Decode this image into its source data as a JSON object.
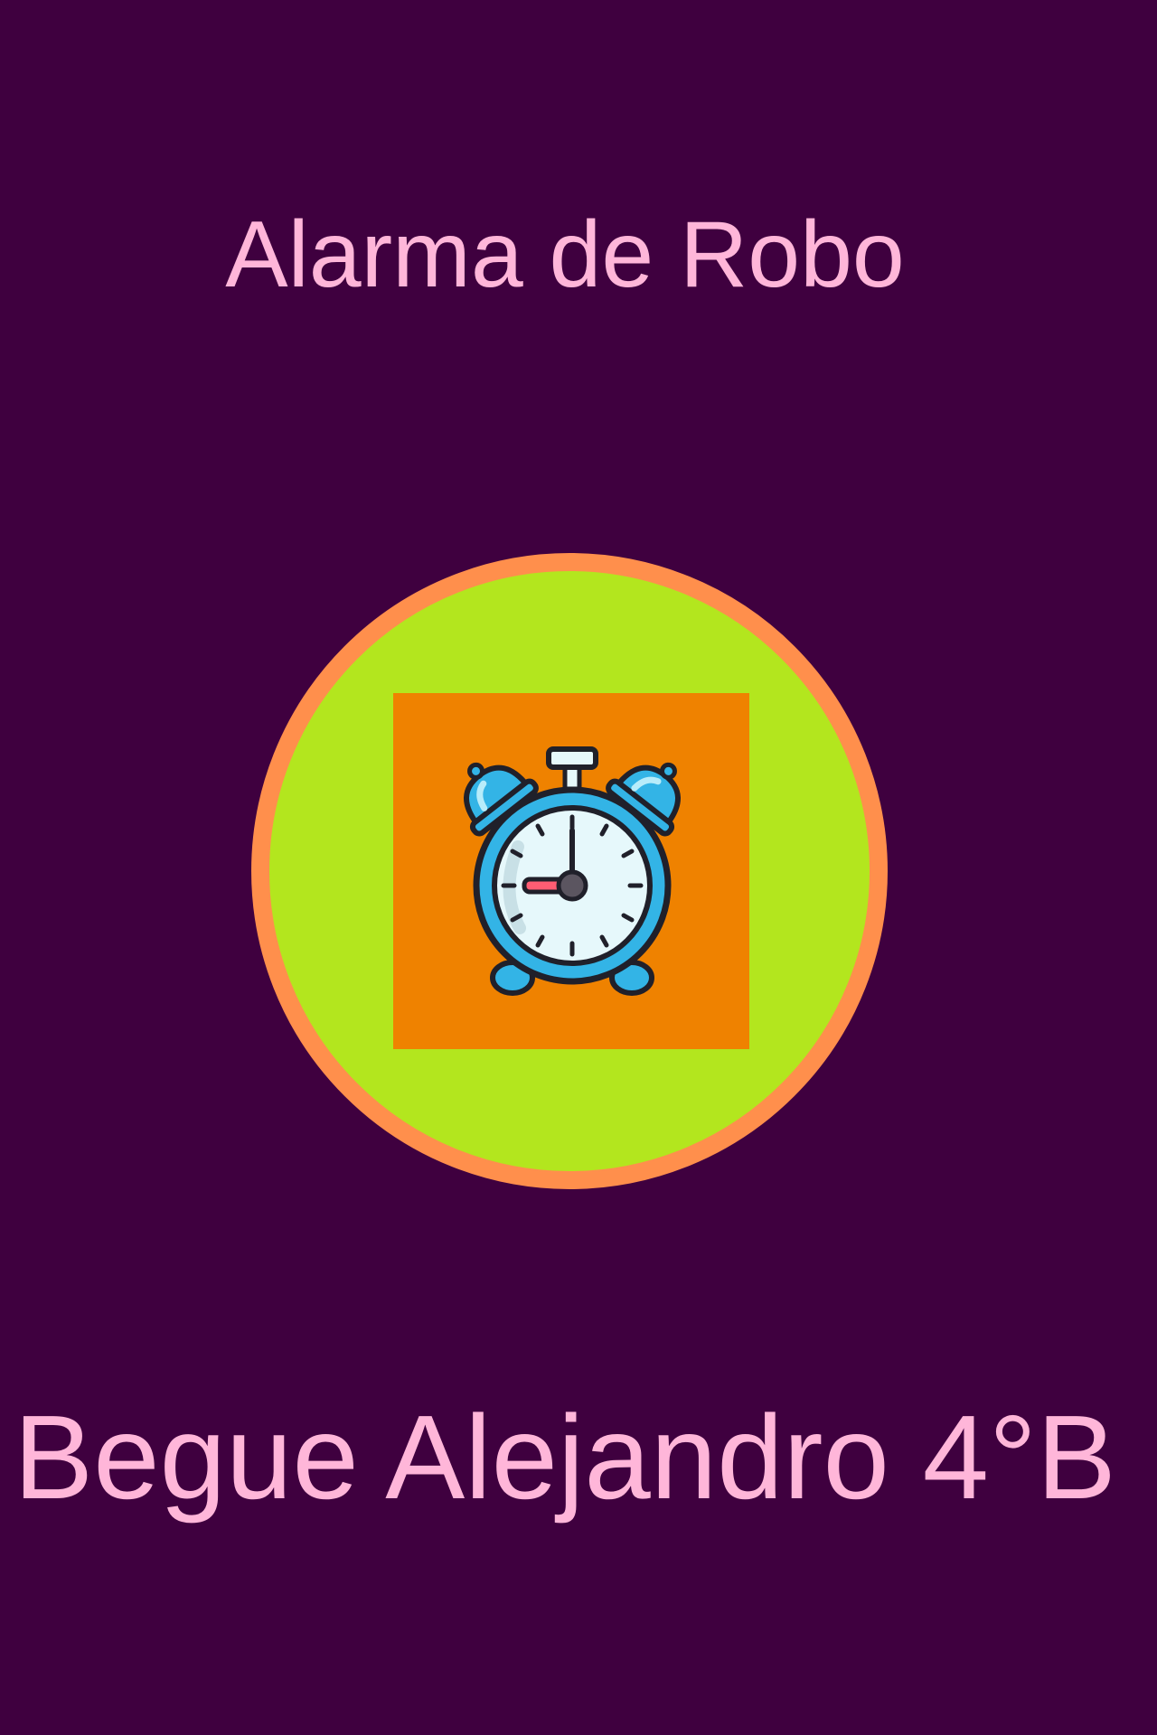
{
  "screen": {
    "title": "Alarma de Robo",
    "author": "Begue Alejandro 4°B",
    "icon": "alarm-clock-icon"
  },
  "colors": {
    "background": "#3f003f",
    "text": "#ffb6d9",
    "circle_fill": "#b3e61e",
    "circle_border": "#ff8f4c",
    "tile": "#ef8200",
    "clock_blue": "#33b4e6",
    "clock_face": "#e6f8fb"
  }
}
